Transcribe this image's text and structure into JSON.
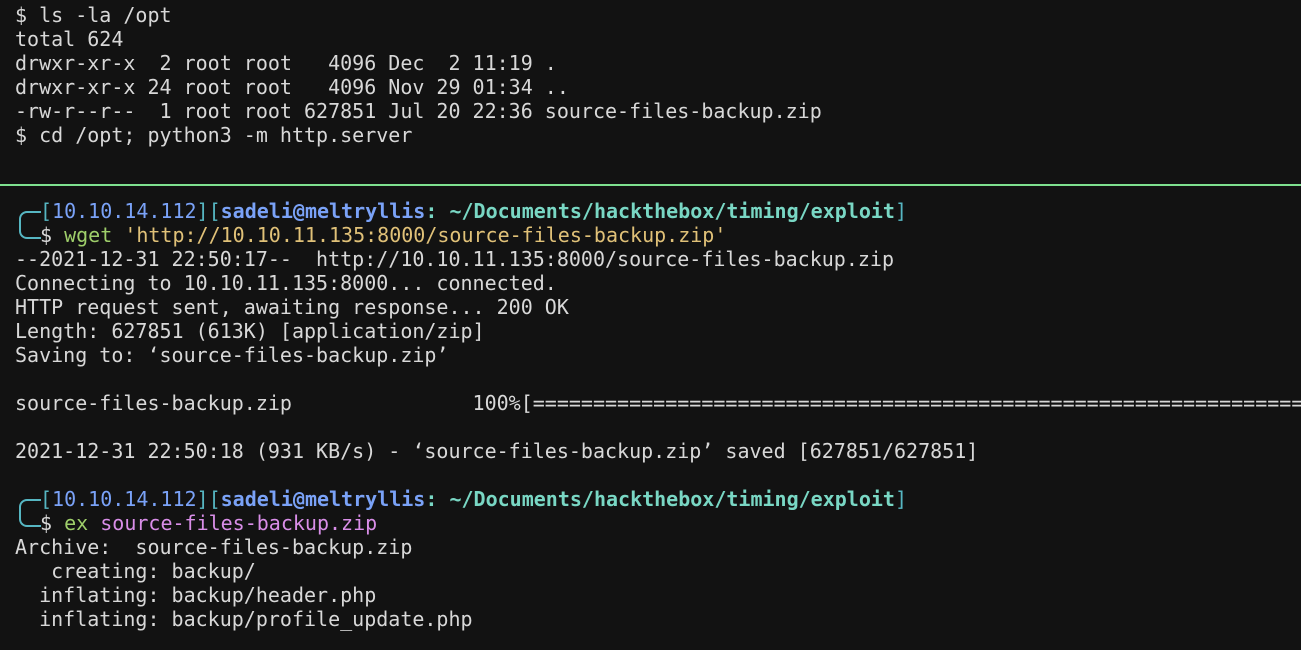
{
  "top_pane": {
    "lines": [
      "$ ls -la /opt",
      "total 624",
      "drwxr-xr-x  2 root root   4096 Dec  2 11:19 .",
      "drwxr-xr-x 24 root root   4096 Nov 29 01:34 ..",
      "-rw-r--r--  1 root root 627851 Jul 20 22:36 source-files-backup.zip",
      "$ cd /opt; python3 -m http.server"
    ]
  },
  "prompt": {
    "open_bracket": "[",
    "ip": "10.10.14.112",
    "mid_bracket": "][",
    "user": "sadeli",
    "at": "@",
    "host": "meltryllis",
    "colon": ":",
    "path": " ~/Documents/hackthebox/timing/exploit",
    "close_bracket": "]",
    "dollar": "$ "
  },
  "cmd1": {
    "name": "wget",
    "arg": "'http://10.10.11.135:8000/source-files-backup.zip'"
  },
  "wget_output": [
    "--2021-12-31 22:50:17--  http://10.10.11.135:8000/source-files-backup.zip",
    "Connecting to 10.10.11.135:8000... connected.",
    "HTTP request sent, awaiting response... 200 OK",
    "Length: 627851 (613K) [application/zip]",
    "Saving to: ‘source-files-backup.zip’",
    "",
    "source-files-backup.zip               100%[=========================================================================",
    "",
    "2021-12-31 22:50:18 (931 KB/s) - ‘source-files-backup.zip’ saved [627851/627851]"
  ],
  "cmd2": {
    "name": "ex",
    "arg": "source-files-backup.zip"
  },
  "ex_output": [
    "Archive:  source-files-backup.zip",
    "   creating: backup/",
    "  inflating: backup/header.php",
    "  inflating: backup/profile_update.php"
  ],
  "colors": {
    "background": "#121212",
    "divider": "#7ee08f",
    "text": "#d8d8d8",
    "ip": "#7aa2f7",
    "path": "#79d7c4",
    "command": "#9ece6a",
    "string_arg": "#e0c178",
    "file_arg": "#d98ee8"
  }
}
